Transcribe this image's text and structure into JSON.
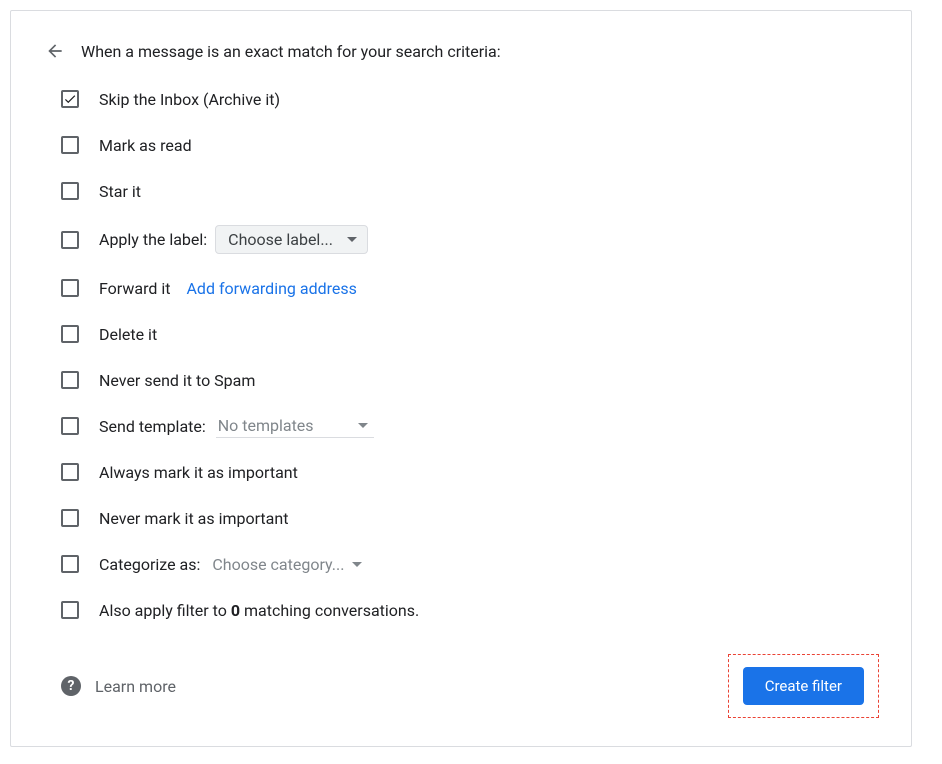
{
  "header": {
    "title": "When a message is an exact match for your search criteria:"
  },
  "options": {
    "skip_inbox": "Skip the Inbox (Archive it)",
    "mark_read": "Mark as read",
    "star_it": "Star it",
    "apply_label": "Apply the label:",
    "apply_label_choose": "Choose label...",
    "forward_it": "Forward it",
    "forward_link": "Add forwarding address",
    "delete_it": "Delete it",
    "never_spam": "Never send it to Spam",
    "send_template": "Send template:",
    "send_template_value": "No templates",
    "always_important": "Always mark it as important",
    "never_important": "Never mark it as important",
    "categorize_as": "Categorize as:",
    "categorize_value": "Choose category...",
    "also_apply_prefix": "Also apply filter to ",
    "also_apply_count": "0",
    "also_apply_suffix": " matching conversations."
  },
  "footer": {
    "learn_more": "Learn more",
    "create_filter": "Create filter"
  }
}
